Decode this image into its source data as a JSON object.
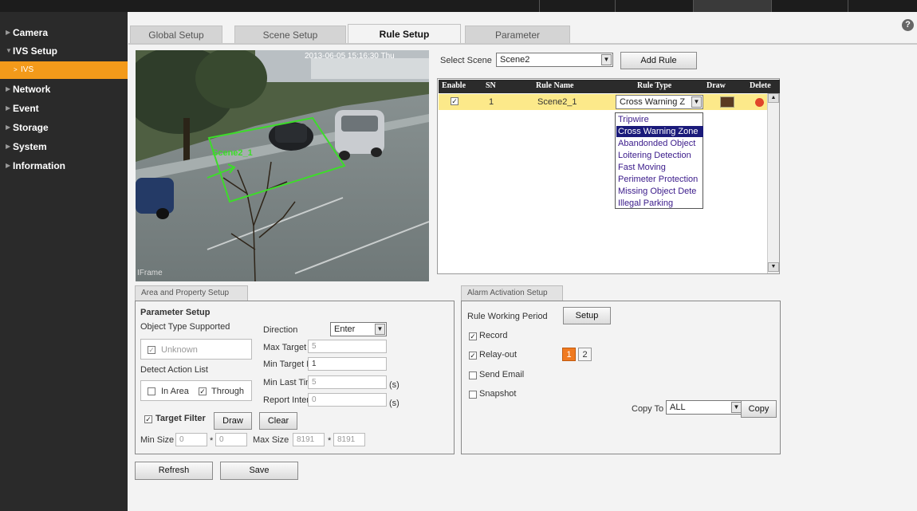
{
  "sidebar": {
    "items": [
      {
        "label": "Camera"
      },
      {
        "label": "IVS Setup"
      },
      {
        "label": "IVS"
      },
      {
        "label": "Network"
      },
      {
        "label": "Event"
      },
      {
        "label": "Storage"
      },
      {
        "label": "System"
      },
      {
        "label": "Information"
      }
    ]
  },
  "tabs": [
    {
      "label": "Global Setup"
    },
    {
      "label": "Scene Setup"
    },
    {
      "label": "Rule Setup"
    },
    {
      "label": "Parameter"
    }
  ],
  "video": {
    "timestamp": "2013-06-05 15:16:30 Thu",
    "zone_label": "Scene2_1",
    "corner_label": "IFrame"
  },
  "scene": {
    "label": "Select Scene",
    "value": "Scene2",
    "add_rule": "Add Rule"
  },
  "rules_table": {
    "headers": [
      "Enable",
      "SN",
      "Rule Name",
      "Rule Type",
      "Draw",
      "Delete"
    ],
    "row": {
      "enabled": "✓",
      "sn": "1",
      "name": "Scene2_1",
      "type": "Cross Warning Z"
    },
    "options": [
      "Tripwire",
      "Cross Warning Zone",
      "Abandonded Object",
      "Loitering Detection",
      "Fast Moving",
      "Perimeter Protection",
      "Missing Object Dete",
      "Illegal Parking"
    ]
  },
  "area": {
    "tab": "Area and Property Setup",
    "param_title": "Parameter Setup",
    "object_type_label": "Object Type Supported",
    "unknown": "Unknown",
    "detect_action": "Detect Action List",
    "in_area": "In Area",
    "through": "Through",
    "direction_label": "Direction",
    "direction_value": "Enter",
    "max_target_label": "Max Target No.",
    "max_target": "5",
    "min_target_label": "Min Target No.",
    "min_target": "1",
    "min_last_label": "Min Last Time",
    "min_last": "5",
    "report_label": "Report Interval",
    "report": "0",
    "unit_s": "(s)",
    "target_filter": "Target Filter",
    "draw": "Draw",
    "clear": "Clear",
    "min_size_label": "Min Size",
    "min_w": "0",
    "min_h": "0",
    "max_size_label": "Max Size",
    "max_w": "8191",
    "max_h": "8191",
    "times": "*"
  },
  "alarm": {
    "tab": "Alarm Activation Setup",
    "working_period": "Rule Working Period",
    "setup": "Setup",
    "record": "Record",
    "relay_out": "Relay-out",
    "relay_1": "1",
    "relay_2": "2",
    "send_email": "Send Email",
    "snapshot": "Snapshot",
    "copy_to_label": "Copy To",
    "copy_to_value": "ALL",
    "copy": "Copy"
  },
  "footer": {
    "refresh": "Refresh",
    "save": "Save"
  },
  "colors": {
    "accent": "#f39a1a",
    "zone": "#3ddc2a",
    "rule_row": "#fce98a"
  }
}
